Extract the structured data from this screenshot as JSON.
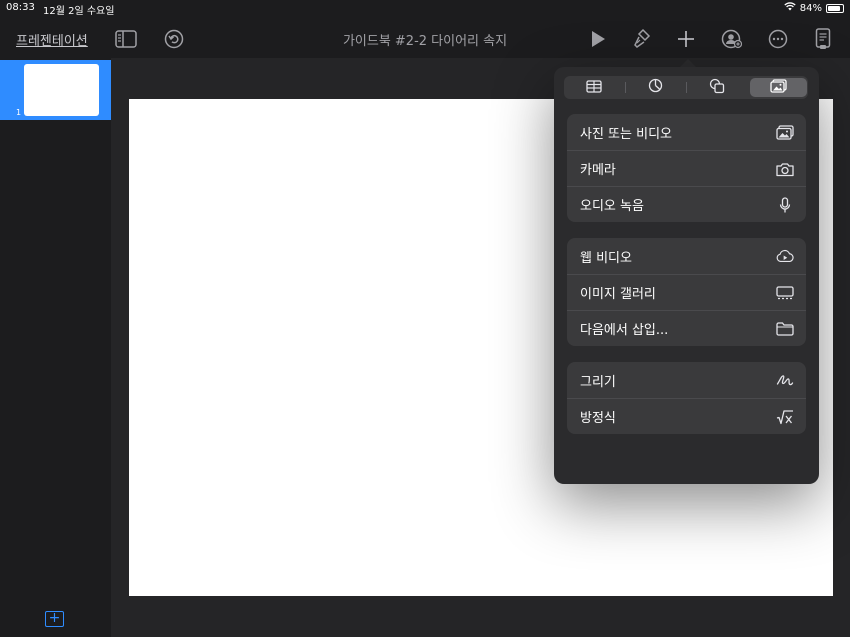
{
  "status_bar": {
    "time": "08:33",
    "date": "12월 2일 수요일",
    "battery": "84%"
  },
  "toolbar": {
    "back_label": "프레젠테이션",
    "document_title": "가이드북 #2-2 다이어리 속지"
  },
  "sidebar": {
    "slides": [
      {
        "number": "1"
      }
    ],
    "add_slide_label": "+"
  },
  "insert_popover": {
    "tabs": [
      {
        "name": "table",
        "icon": "table-icon",
        "active": false
      },
      {
        "name": "chart",
        "icon": "chart-icon",
        "active": false
      },
      {
        "name": "shape",
        "icon": "shapes-icon",
        "active": false
      },
      {
        "name": "media",
        "icon": "media-icon",
        "active": true
      }
    ],
    "group1": [
      {
        "label": "사진 또는 비디오",
        "icon": "photo-icon"
      },
      {
        "label": "카메라",
        "icon": "camera-icon"
      },
      {
        "label": "오디오 녹음",
        "icon": "microphone-icon"
      }
    ],
    "group2": [
      {
        "label": "웹 비디오",
        "icon": "cloud-play-icon"
      },
      {
        "label": "이미지 갤러리",
        "icon": "gallery-icon"
      },
      {
        "label": "다음에서 삽입...",
        "icon": "folder-icon"
      }
    ],
    "group3": [
      {
        "label": "그리기",
        "icon": "drawing-icon"
      },
      {
        "label": "방정식",
        "icon": "equation-icon"
      }
    ]
  },
  "colors": {
    "accent": "#2f8cff",
    "background": "#1c1c1e",
    "popover": "#2b2b2d"
  }
}
